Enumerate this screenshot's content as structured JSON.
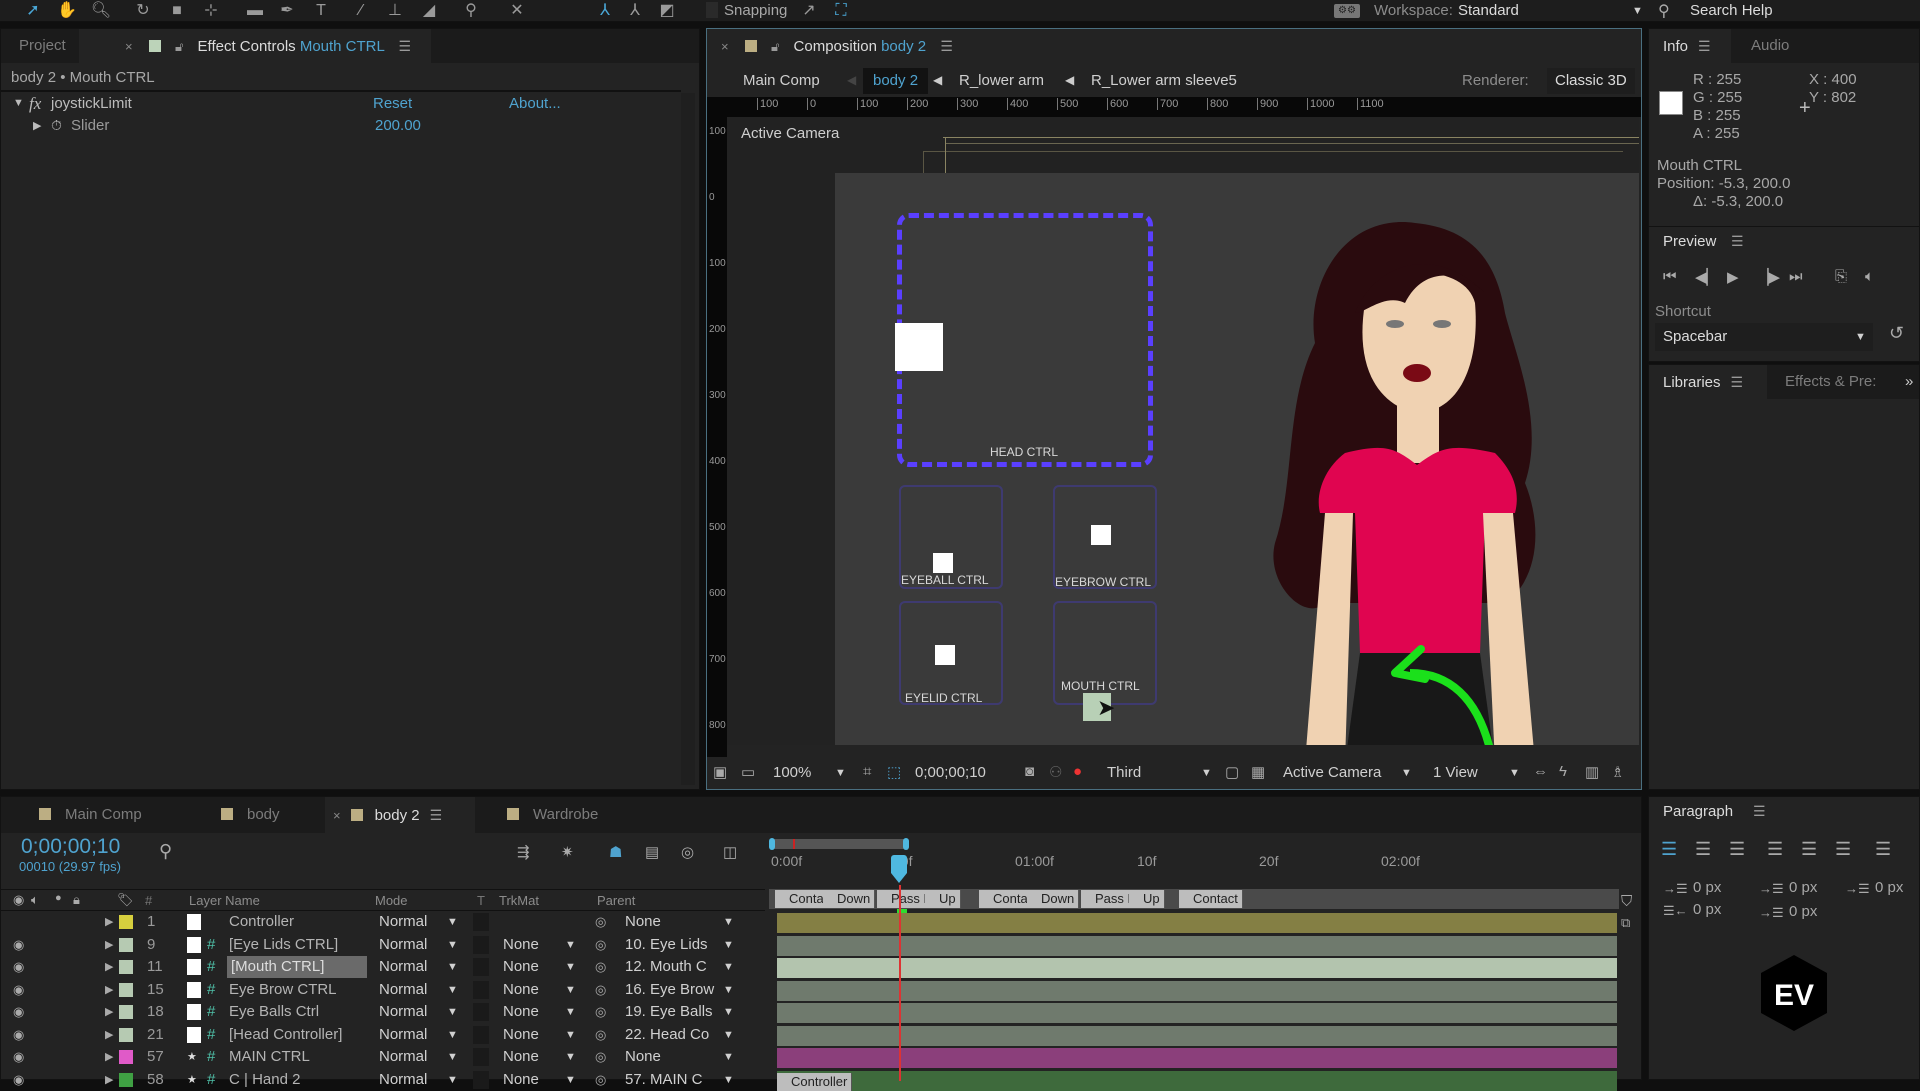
{
  "toolbar": {
    "tools": [
      "selection-tool",
      "hand-tool",
      "zoom-tool",
      "orbit-tool",
      "camera-tool",
      "pan-behind-tool",
      "rectangle-tool",
      "pen-tool",
      "type-tool",
      "brush-tool",
      "clone-stamp-tool",
      "eraser-tool",
      "roto-brush-tool",
      "puppet-tool"
    ],
    "snapping_label": "Snapping",
    "workspace_label": "Workspace:",
    "workspace_value": "Standard",
    "search_placeholder": "Search Help"
  },
  "effect_controls": {
    "tab_project": "Project",
    "tab_title": "Effect Controls",
    "tab_layer": "Mouth CTRL",
    "breadcrumb": "body 2 • Mouth CTRL",
    "effect_name": "joystickLimit",
    "reset_label": "Reset",
    "about_label": "About...",
    "param_name": "Slider",
    "param_value": "200.00"
  },
  "composition": {
    "tab_title": "Composition",
    "tab_comp": "body 2",
    "breadcrumbs": [
      "Main Comp",
      "body 2",
      "R_lower arm",
      "R_Lower arm sleeve5"
    ],
    "renderer_label": "Renderer:",
    "renderer_value": "Classic 3D",
    "ruler_h": [
      "100",
      "0",
      "100",
      "200",
      "300",
      "400",
      "500",
      "600",
      "700",
      "800",
      "900",
      "1000",
      "1100"
    ],
    "ruler_v": [
      "100",
      "0",
      "100",
      "200",
      "300",
      "400",
      "500",
      "600",
      "700",
      "800"
    ],
    "view_label": "Active Camera",
    "controls": [
      {
        "name": "HEAD CTRL"
      },
      {
        "name": "EYEBALL CTRL"
      },
      {
        "name": "EYEBROW CTRL"
      },
      {
        "name": "EYELID CTRL"
      },
      {
        "name": "MOUTH CTRL"
      }
    ],
    "footer": {
      "zoom": "100%",
      "timecode": "0;00;00;10",
      "resolution": "Third",
      "camera": "Active Camera",
      "views": "1 View"
    }
  },
  "info": {
    "tab_info": "Info",
    "tab_audio": "Audio",
    "r": "R : 255",
    "g": "G : 255",
    "b": "B : 255",
    "a": "A : 255",
    "x": "X : 400",
    "y": "Y : 802",
    "layer": "Mouth CTRL",
    "position": "Position: -5.3, 200.0",
    "delta": "Δ: -5.3, 200.0",
    "swatch_color": "#ffffff"
  },
  "preview": {
    "title": "Preview",
    "shortcut_label": "Shortcut",
    "shortcut_value": "Spacebar"
  },
  "libraries": {
    "tab_libraries": "Libraries",
    "tab_effects": "Effects & Pre:"
  },
  "paragraph": {
    "title": "Paragraph",
    "indent_left": "0 px",
    "space_before": "0 px",
    "indent_first": "0 px",
    "indent_right": "0 px",
    "space_after": "0 px"
  },
  "timeline": {
    "tabs": [
      "Main Comp",
      "body",
      "body 2",
      "Wardrobe"
    ],
    "active_tab": "body 2",
    "timecode": "0;00;00;10",
    "frame_info": "00010 (29.97 fps)",
    "columns": {
      "num": "#",
      "layer_name": "Layer Name",
      "mode": "Mode",
      "t": "T",
      "trkmat": "TrkMat",
      "parent": "Parent"
    },
    "time_ticks": [
      "0:00f",
      "20f",
      "01:00f",
      "10f",
      "20f",
      "02:00f"
    ],
    "markers": [
      "Conta",
      "Down",
      "Pass P",
      "Up",
      "Conta",
      "Down",
      "Pass P",
      "Up",
      "Contact"
    ],
    "layers": [
      {
        "num": "1",
        "name": "Controller",
        "label_color": "#d6cf3e",
        "mode": "Normal",
        "trkmat": "",
        "parent": "None",
        "eye": false,
        "star": false,
        "hash": false,
        "bar_color": "#847f44",
        "selected": false
      },
      {
        "num": "9",
        "name": "[Eye Lids CTRL]",
        "label_color": "#b6cab2",
        "mode": "Normal",
        "trkmat": "None",
        "parent": "10. Eye Lids",
        "eye": true,
        "star": false,
        "hash": true,
        "bar_color": "#6f7a6d",
        "selected": false
      },
      {
        "num": "11",
        "name": "[Mouth CTRL]",
        "label_color": "#b6cab2",
        "mode": "Normal",
        "trkmat": "None",
        "parent": "12. Mouth C",
        "eye": true,
        "star": false,
        "hash": true,
        "bar_color": "#b3c4ae",
        "selected": true
      },
      {
        "num": "15",
        "name": "Eye Brow CTRL",
        "label_color": "#b6cab2",
        "mode": "Normal",
        "trkmat": "None",
        "parent": "16. Eye Brow",
        "eye": true,
        "star": false,
        "hash": true,
        "bar_color": "#6f7a6d",
        "selected": false
      },
      {
        "num": "18",
        "name": "Eye Balls Ctrl",
        "label_color": "#b6cab2",
        "mode": "Normal",
        "trkmat": "None",
        "parent": "19. Eye Balls",
        "eye": true,
        "star": false,
        "hash": true,
        "bar_color": "#6f7a6d",
        "selected": false
      },
      {
        "num": "21",
        "name": "[Head Controller]",
        "label_color": "#b6cab2",
        "mode": "Normal",
        "trkmat": "None",
        "parent": "22. Head Co",
        "eye": true,
        "star": false,
        "hash": true,
        "bar_color": "#6f7a6d",
        "selected": false
      },
      {
        "num": "57",
        "name": "MAIN CTRL",
        "label_color": "#e05ac8",
        "mode": "Normal",
        "trkmat": "None",
        "parent": "None",
        "eye": true,
        "star": true,
        "hash": true,
        "bar_color": "#8b3f7b",
        "selected": false
      },
      {
        "num": "58",
        "name": "C | Hand 2",
        "label_color": "#3fa043",
        "mode": "Normal",
        "trkmat": "None",
        "parent": "57. MAIN C",
        "eye": true,
        "star": true,
        "hash": true,
        "bar_color": "#3e6a3c",
        "selected": false
      }
    ],
    "bar_marker_label": "Controller"
  },
  "watermark": "EV"
}
